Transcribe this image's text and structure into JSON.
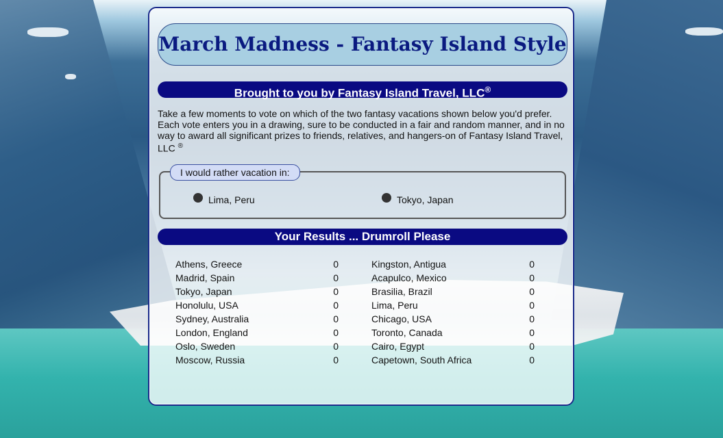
{
  "page": {
    "title": "March Madness - Fantasy Island Style",
    "sponsor_text": "Brought to you by Fantasy Island Travel, LLC",
    "sponsor_mark": "®",
    "intro_text": "Take a few moments to vote on which of the two fantasy vacations shown below you'd prefer. Each vote enters you in a drawing, sure to be conducted in a fair and random manner, and in no way to award all significant prizes to friends, relatives, and hangers-on of Fantasy Island Travel, LLC",
    "intro_mark": "®"
  },
  "vote": {
    "legend": "I would rather vacation in:",
    "options": [
      {
        "label": "Lima, Peru"
      },
      {
        "label": "Tokyo, Japan"
      }
    ]
  },
  "results": {
    "header": "Your Results ... Drumroll Please",
    "left": [
      {
        "city": "Athens, Greece",
        "count": "0"
      },
      {
        "city": "Madrid, Spain",
        "count": "0"
      },
      {
        "city": "Tokyo, Japan",
        "count": "0"
      },
      {
        "city": "Honolulu, USA",
        "count": "0"
      },
      {
        "city": "Sydney, Australia",
        "count": "0"
      },
      {
        "city": "London, England",
        "count": "0"
      },
      {
        "city": "Oslo, Sweden",
        "count": "0"
      },
      {
        "city": "Moscow, Russia",
        "count": "0"
      }
    ],
    "right": [
      {
        "city": "Kingston, Antigua",
        "count": "0"
      },
      {
        "city": "Acapulco, Mexico",
        "count": "0"
      },
      {
        "city": "Brasilia, Brazil",
        "count": "0"
      },
      {
        "city": "Lima, Peru",
        "count": "0"
      },
      {
        "city": "Chicago, USA",
        "count": "0"
      },
      {
        "city": "Toronto, Canada",
        "count": "0"
      },
      {
        "city": "Cairo, Egypt",
        "count": "0"
      },
      {
        "city": "Capetown, South Africa",
        "count": "0"
      }
    ]
  },
  "colors": {
    "title_text": "#0a1a80",
    "banner_bg": "#a8cfe2",
    "bar_bg": "#0a0a82",
    "legend_bg": "#d3dcf6"
  }
}
